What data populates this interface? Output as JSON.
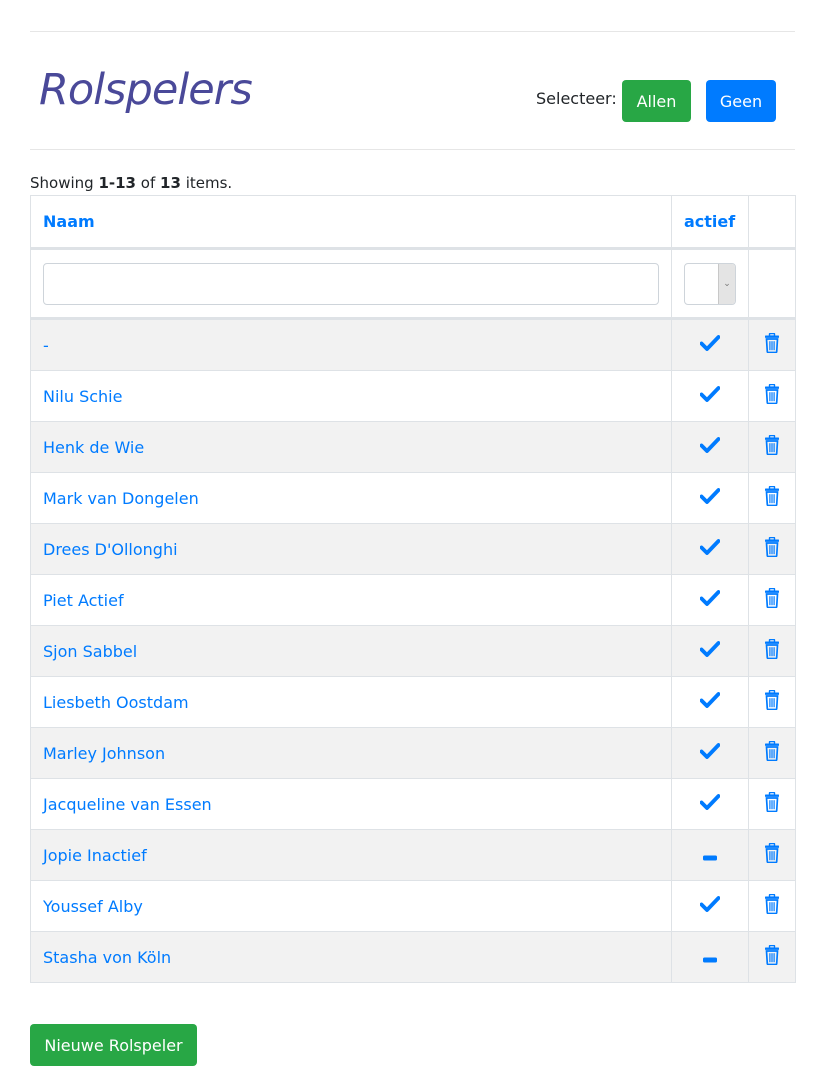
{
  "page": {
    "title": "Rolspelers",
    "select_label": "Selecteer:",
    "select_all_label": "Allen",
    "select_none_label": "Geen"
  },
  "summary": {
    "prefix": "Showing",
    "range": "1-13",
    "of": "of",
    "total": "13",
    "suffix": "items."
  },
  "table": {
    "columns": {
      "name": "Naam",
      "active": "actief"
    },
    "filter": {
      "name_value": "",
      "active_value": ""
    },
    "rows": [
      {
        "name": "-",
        "active": true
      },
      {
        "name": "Nilu Schie",
        "active": true
      },
      {
        "name": "Henk de Wie",
        "active": true
      },
      {
        "name": "Mark van Dongelen",
        "active": true
      },
      {
        "name": "Drees D'Ollonghi",
        "active": true
      },
      {
        "name": "Piet Actief",
        "active": true
      },
      {
        "name": "Sjon Sabbel",
        "active": true
      },
      {
        "name": "Liesbeth Oostdam",
        "active": true
      },
      {
        "name": "Marley Johnson",
        "active": true
      },
      {
        "name": "Jacqueline van Essen",
        "active": true
      },
      {
        "name": "Jopie Inactief",
        "active": false
      },
      {
        "name": "Youssef Alby",
        "active": true
      },
      {
        "name": "Stasha von Köln",
        "active": false
      }
    ],
    "icons": {
      "active": "check-icon",
      "inactive": "minus-icon",
      "delete": "trash-icon"
    }
  },
  "actions": {
    "new_label": "Nieuwe Rolspeler"
  },
  "colors": {
    "title": "#4a4999",
    "link": "#007bff",
    "green": "#28a745",
    "blue": "#007bff"
  }
}
